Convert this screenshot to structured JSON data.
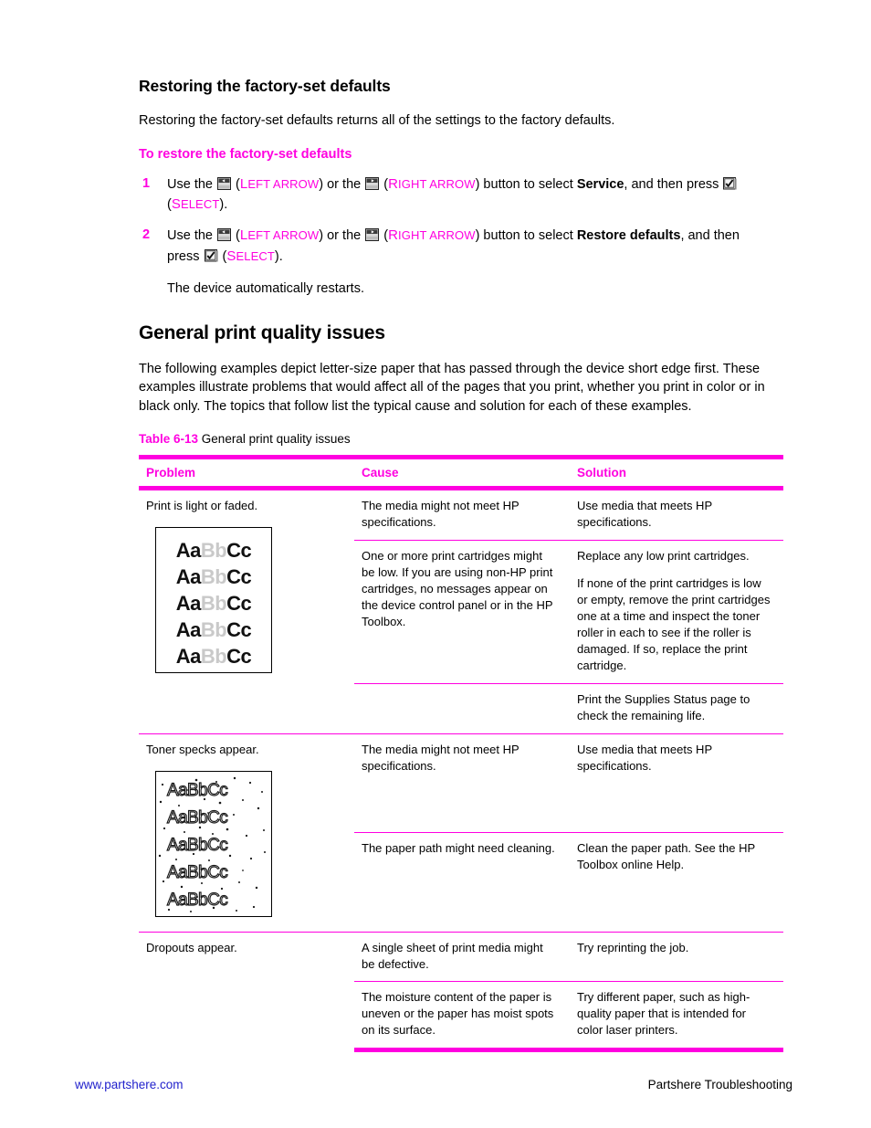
{
  "section": {
    "heading": "Restoring the factory-set defaults",
    "intro": "Restoring the factory-set defaults returns all of the settings to the factory defaults.",
    "procedure_heading": "To restore the factory-set defaults",
    "steps": [
      {
        "num": "1",
        "pre": "Use the ",
        "mid1": ") or the ",
        "mid2": ") button to select ",
        "target": "Service",
        "post": ", and then press ",
        "tail_open": "(",
        "tail_close": ").",
        "left_arrow_label_cap": "L",
        "left_arrow_label_rest": "EFT ARROW",
        "right_arrow_label_cap": "R",
        "right_arrow_label_rest": "IGHT ARROW",
        "select_label_cap": "S",
        "select_label_rest": "ELECT"
      },
      {
        "num": "2",
        "pre": "Use the ",
        "mid1": ") or the ",
        "mid2": ") button to select ",
        "target": "Restore defaults",
        "post": ", and then press ",
        "tail_open": "(",
        "tail_close": ").",
        "left_arrow_label_cap": "L",
        "left_arrow_label_rest": "EFT ARROW",
        "right_arrow_label_cap": "R",
        "right_arrow_label_rest": "IGHT ARROW",
        "select_label_cap": "S",
        "select_label_rest": "ELECT"
      }
    ],
    "step2_note": "The device automatically restarts."
  },
  "quality": {
    "heading": "General print quality issues",
    "paragraph": "The following examples depict letter-size paper that has passed through the device short edge first. These examples illustrate problems that would affect all of the pages that you print, whether you print in color or in black only. The topics that follow list the typical cause and solution for each of these examples.",
    "table_caption_label": "Table 6-13",
    "table_caption_text": "General print quality issues",
    "columns": [
      "Problem",
      "Cause",
      "Solution"
    ],
    "groups": [
      {
        "problem": "Print is light or faded.",
        "sample": "faded-aabbcc",
        "sample_lines": [
          "AaBbCc",
          "AaBbCc",
          "AaBbCc",
          "AaBbCc",
          "AaBbCc"
        ],
        "rows": [
          {
            "cause": [
              "The media might not meet HP specifications."
            ],
            "solution": [
              "Use media that meets HP specifications."
            ]
          },
          {
            "cause": [
              "One or more print cartridges might be low. If you are using non-HP print cartridges, no messages appear on the device control panel or in the HP Toolbox."
            ],
            "solution": [
              "Replace any low print cartridges.",
              "If none of the print cartridges is low or empty, remove the print cartridges one at a time and inspect the toner roller in each to see if the roller is damaged. If so, replace the print cartridge."
            ]
          },
          {
            "cause": [
              ""
            ],
            "solution": [
              "Print the Supplies Status page to check the remaining life."
            ]
          }
        ]
      },
      {
        "problem": "Toner specks appear.",
        "sample": "specks-aabbcc",
        "sample_lines": [
          "AaBbCc",
          "AaBbCc",
          "AaBbCc",
          "AaBbCc",
          "AaBbCc"
        ],
        "rows": [
          {
            "cause": [
              "The media might not meet HP specifications."
            ],
            "solution": [
              "Use media that meets HP specifications."
            ]
          },
          {
            "cause": [
              "The paper path might need cleaning."
            ],
            "solution": [
              "Clean the paper path. See the HP Toolbox online Help."
            ]
          }
        ]
      },
      {
        "problem": "Dropouts appear.",
        "sample": "",
        "sample_lines": [],
        "rows": [
          {
            "cause": [
              "A single sheet of print media might be defective."
            ],
            "solution": [
              "Try reprinting the job."
            ]
          },
          {
            "cause": [
              "The moisture content of the paper is uneven or the paper has moist spots on its surface."
            ],
            "solution": [
              "Try different paper, such as high-quality paper that is intended for color laser printers."
            ]
          }
        ]
      }
    ]
  },
  "footer": {
    "url": "www.partshere.com",
    "right": "Partshere Troubleshooting"
  },
  "colors": {
    "accent_magenta": "#FF00E0",
    "link_blue": "#2222CC",
    "faded_gray": "#c9c9c9"
  },
  "icons": {
    "left_arrow": "left-arrow-button-icon",
    "right_arrow": "right-arrow-button-icon",
    "select": "select-checkmark-button-icon"
  }
}
